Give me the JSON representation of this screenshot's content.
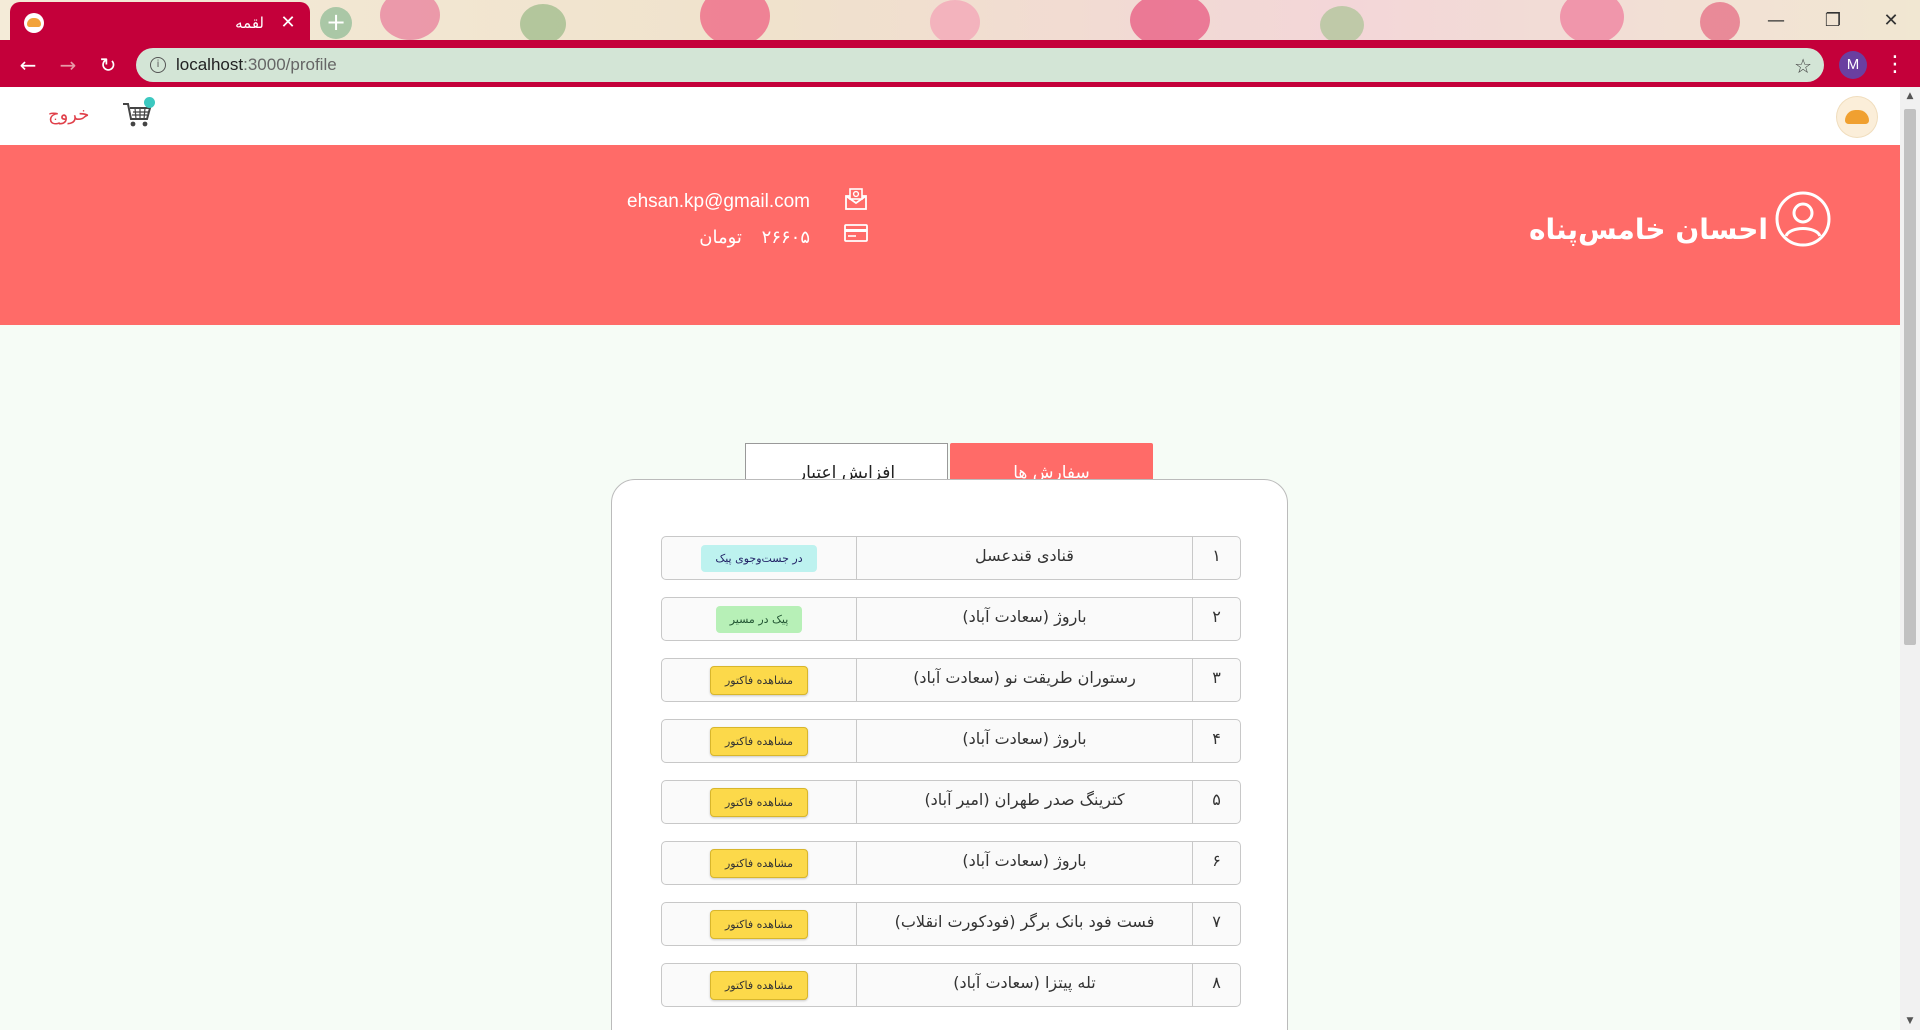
{
  "browser": {
    "tab_title": "لقمه",
    "url_host": "localhost",
    "url_path": ":3000/profile",
    "profile_initial": "M"
  },
  "navbar": {
    "logout_label": "خروج"
  },
  "profile": {
    "name": "احسان خامس‌پناه",
    "email": "ehsan.kp@gmail.com",
    "credit_amount": "۲۶۶۰۵",
    "credit_currency": "تومان"
  },
  "tabs": {
    "orders_label": "سفارش ها",
    "credit_label": "افزایش اعتبار"
  },
  "orders": [
    {
      "num": "۱",
      "restaurant": "قنادی قندعسل",
      "status": "در جست‌وجوی پیک",
      "kind": "search"
    },
    {
      "num": "۲",
      "restaurant": "باروژ (سعادت آباد)",
      "status": "پیک در مسیر",
      "kind": "route"
    },
    {
      "num": "۳",
      "restaurant": "رستوران طریقت نو (سعادت آباد)",
      "status": "مشاهده فاکتور",
      "kind": "invoice"
    },
    {
      "num": "۴",
      "restaurant": "باروژ (سعادت آباد)",
      "status": "مشاهده فاکتور",
      "kind": "invoice"
    },
    {
      "num": "۵",
      "restaurant": "کترینگ صدر طهران (امیر آباد)",
      "status": "مشاهده فاکتور",
      "kind": "invoice"
    },
    {
      "num": "۶",
      "restaurant": "باروژ (سعادت آباد)",
      "status": "مشاهده فاکتور",
      "kind": "invoice"
    },
    {
      "num": "۷",
      "restaurant": "فست فود بانک برگر (فودکورت انقلاب)",
      "status": "مشاهده فاکتور",
      "kind": "invoice"
    },
    {
      "num": "۸",
      "restaurant": "تله پیتزا (سعادت آباد)",
      "status": "مشاهده فاکتور",
      "kind": "invoice"
    }
  ]
}
